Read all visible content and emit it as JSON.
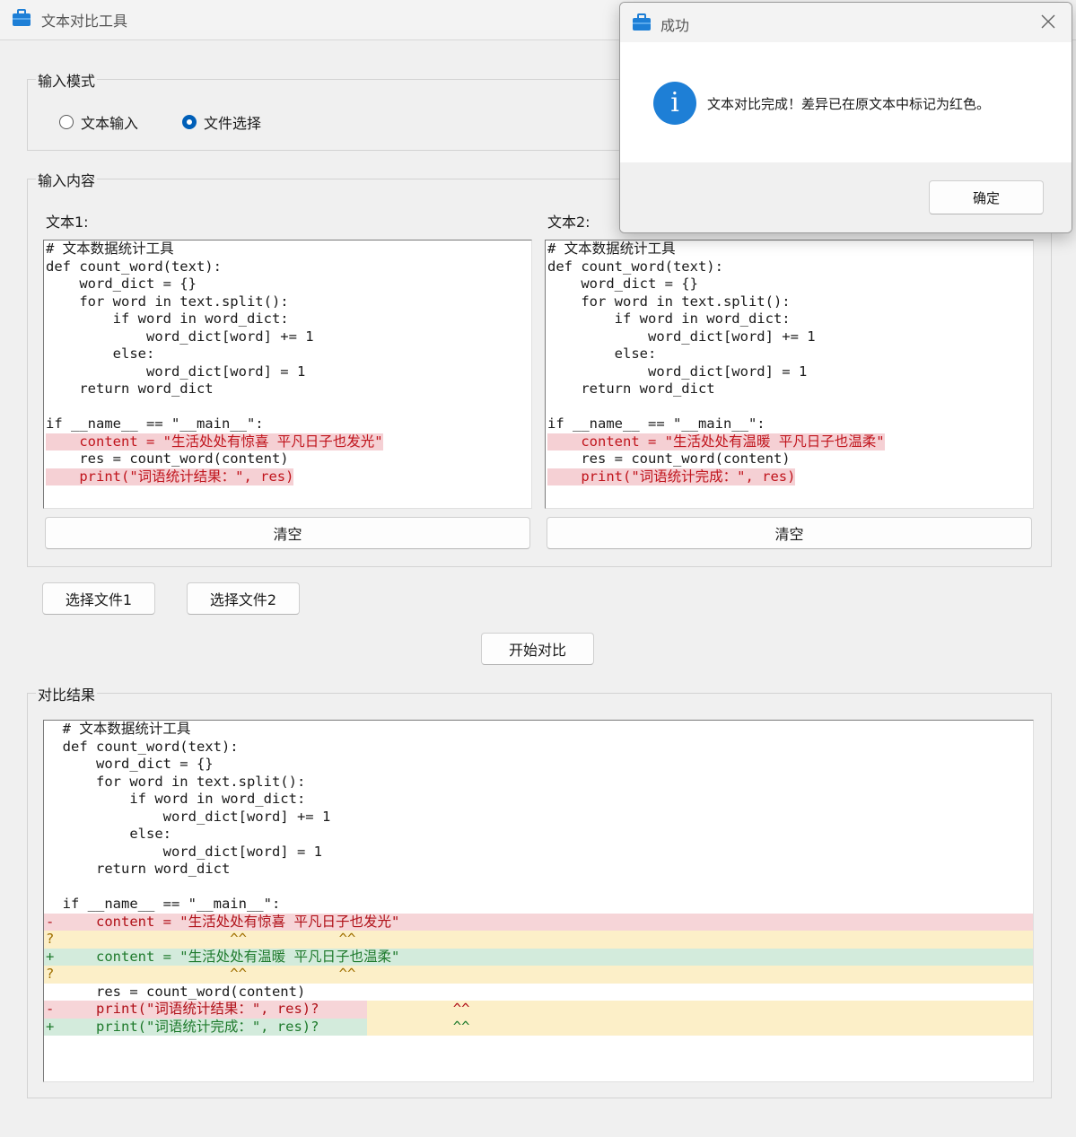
{
  "window": {
    "title": "文本对比工具"
  },
  "input_mode": {
    "label": "输入模式",
    "options": [
      {
        "label": "文本输入",
        "checked": false
      },
      {
        "label": "文件选择",
        "checked": true
      }
    ]
  },
  "input_content": {
    "label": "输入内容",
    "text1_label": "文本1:",
    "text2_label": "文本2:",
    "text1_lines": [
      {
        "text": "# 文本数据统计工具",
        "hl": ""
      },
      {
        "text": "def count_word(text):",
        "hl": ""
      },
      {
        "text": "    word_dict = {}",
        "hl": ""
      },
      {
        "text": "    for word in text.split():",
        "hl": ""
      },
      {
        "text": "        if word in word_dict:",
        "hl": ""
      },
      {
        "text": "            word_dict[word] += 1",
        "hl": ""
      },
      {
        "text": "        else:",
        "hl": ""
      },
      {
        "text": "            word_dict[word] = 1",
        "hl": ""
      },
      {
        "text": "    return word_dict",
        "hl": ""
      },
      {
        "text": "",
        "hl": ""
      },
      {
        "text": "if __name__ == \"__main__\":",
        "hl": ""
      },
      {
        "text": "    content = \"生活处处有惊喜 平凡日子也发光\"",
        "hl": "red"
      },
      {
        "text": "    res = count_word(content)",
        "hl": ""
      },
      {
        "text": "    print(\"词语统计结果：\", res)",
        "hl": "red"
      }
    ],
    "text2_lines": [
      {
        "text": "# 文本数据统计工具",
        "hl": ""
      },
      {
        "text": "def count_word(text):",
        "hl": ""
      },
      {
        "text": "    word_dict = {}",
        "hl": ""
      },
      {
        "text": "    for word in text.split():",
        "hl": ""
      },
      {
        "text": "        if word in word_dict:",
        "hl": ""
      },
      {
        "text": "            word_dict[word] += 1",
        "hl": ""
      },
      {
        "text": "        else:",
        "hl": ""
      },
      {
        "text": "            word_dict[word] = 1",
        "hl": ""
      },
      {
        "text": "    return word_dict",
        "hl": ""
      },
      {
        "text": "",
        "hl": ""
      },
      {
        "text": "if __name__ == \"__main__\":",
        "hl": ""
      },
      {
        "text": "    content = \"生活处处有温暖 平凡日子也温柔\"",
        "hl": "red"
      },
      {
        "text": "    res = count_word(content)",
        "hl": ""
      },
      {
        "text": "    print(\"词语统计完成：\", res)",
        "hl": "red"
      }
    ],
    "clear1_label": "清空",
    "clear2_label": "清空"
  },
  "file_buttons": {
    "select1": "选择文件1",
    "select2": "选择文件2"
  },
  "start_button": "开始对比",
  "result": {
    "label": "对比结果",
    "lines": [
      {
        "text": "  # 文本数据统计工具",
        "hl": ""
      },
      {
        "text": "  def count_word(text):",
        "hl": ""
      },
      {
        "text": "      word_dict = {}",
        "hl": ""
      },
      {
        "text": "      for word in text.split():",
        "hl": ""
      },
      {
        "text": "          if word in word_dict:",
        "hl": ""
      },
      {
        "text": "              word_dict[word] += 1",
        "hl": ""
      },
      {
        "text": "          else:",
        "hl": ""
      },
      {
        "text": "              word_dict[word] = 1",
        "hl": ""
      },
      {
        "text": "      return word_dict",
        "hl": ""
      },
      {
        "text": "",
        "hl": ""
      },
      {
        "text": "  if __name__ == \"__main__\":",
        "hl": ""
      },
      {
        "text": "-     content = \"生活处处有惊喜 平凡日子也发光\"",
        "hl": "red"
      },
      {
        "text": "?                     ^^           ^^",
        "hl": "yellow"
      },
      {
        "text": "+     content = \"生活处处有温暖 平凡日子也温柔\"",
        "hl": "green"
      },
      {
        "text": "?                     ^^           ^^",
        "hl": "yellow"
      },
      {
        "text": "      res = count_word(content)",
        "hl": ""
      },
      {
        "text": "-     print(\"词语统计结果：\", res)?                ^^",
        "hl": "red-yellow"
      },
      {
        "text": "+     print(\"词语统计完成：\", res)?                ^^",
        "hl": "green-yellow"
      }
    ]
  },
  "dialog": {
    "title": "成功",
    "message": "文本对比完成！差异已在原文本中标记为红色。",
    "ok_label": "确定"
  },
  "colors": {
    "accent": "#005fb8",
    "diff_red": "#f6d5d8",
    "diff_green": "#d3ebdc",
    "diff_yellow": "#fcefc8"
  }
}
